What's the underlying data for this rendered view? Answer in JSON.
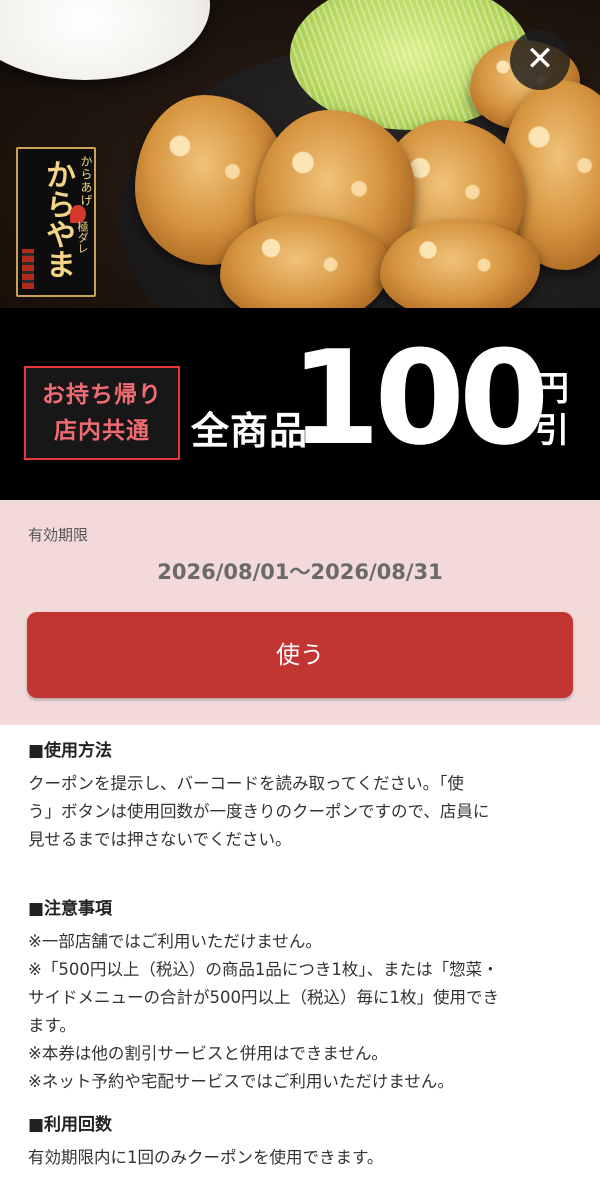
{
  "hero": {
    "logo_small": "からあげ",
    "logo_main": "からやま",
    "logo_sub": "極ダレ",
    "close_icon": "close-icon"
  },
  "banner": {
    "badge_line1": "お持ち帰り",
    "badge_line2": "店内共通",
    "all_items": "全商品",
    "amount": "100",
    "unit_line1": "円",
    "unit_line2": "引"
  },
  "validity": {
    "label": "有効期限",
    "dates": "2026/08/01〜2026/08/31",
    "use_button": "使う"
  },
  "usage": {
    "heading": "■使用方法",
    "lines": [
      "クーポンを提示し、バーコードを読み取ってください。「使",
      "う」ボタンは使用回数が一度きりのクーポンですので、店員に",
      "見せるまでは押さないでください。"
    ]
  },
  "notes": {
    "heading": "■注意事項",
    "lines": [
      "※一部店舗ではご利用いただけません。",
      "※「500円以上（税込）の商品1品につき1枚」、または「惣菜・",
      "サイドメニューの合計が500円以上（税込）毎に1枚」使用でき",
      "ます。",
      "※本券は他の割引サービスと併用はできません。",
      "※ネット予約や宅配サービスではご利用いただけません。"
    ]
  },
  "count": {
    "heading": "■利用回数",
    "lines": [
      "有効期限内に1回のみクーポンを使用できます。"
    ]
  },
  "colors": {
    "accent_red": "#c33533",
    "pink_bg": "#f2d9da",
    "badge_red": "#e9383a"
  }
}
